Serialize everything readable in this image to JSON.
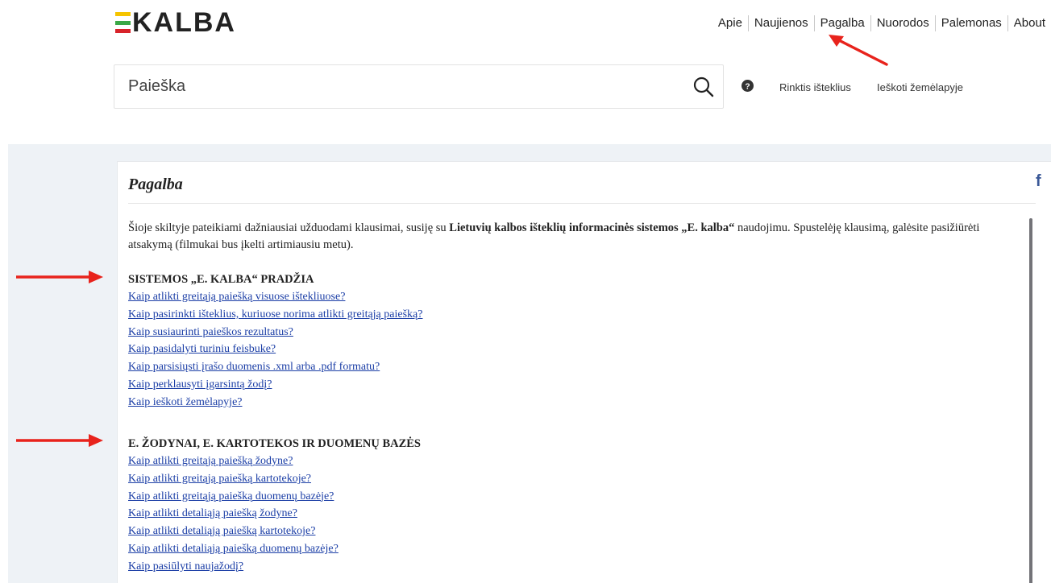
{
  "brand": {
    "name": "KALBA",
    "mark_colors": [
      "#f5c400",
      "#39a846",
      "#d8232a"
    ]
  },
  "nav": {
    "items": [
      {
        "label": "Apie"
      },
      {
        "label": "Naujienos"
      },
      {
        "label": "Pagalba"
      },
      {
        "label": "Nuorodos"
      },
      {
        "label": "Palemonas"
      },
      {
        "label": "About"
      }
    ]
  },
  "search": {
    "placeholder": "Paieška",
    "button_icon": "search-icon",
    "help_icon": "question-circle-icon"
  },
  "aux_links": {
    "choose_resources": "Rinktis išteklius",
    "map_search": "Ieškoti žemėlapyje"
  },
  "page": {
    "title": "Pagalba",
    "share_icon": "facebook-icon",
    "intro_before": "Šioje skiltyje pateikiami dažniausiai užduodami klausimai, susiję su ",
    "intro_bold": "Lietuvių kalbos išteklių informacinės sistemos „E. kalba“",
    "intro_after": " naudojimu. Spustelėję klausimą, galėsite pasižiūrėti atsakymą (filmukai bus įkelti artimiausiu metu)."
  },
  "sections": [
    {
      "heading": "SISTEMOS „E. KALBA“ PRADŽIA",
      "links": [
        "Kaip atlikti greitąją paiešką visuose ištekliuose?",
        "Kaip pasirinkti išteklius, kuriuose norima atlikti greitąją paiešką?",
        "Kaip susiaurinti paieškos rezultatus?",
        "Kaip pasidalyti turiniu feisbuke?",
        "Kaip parsisiųsti įrašo duomenis .xml arba .pdf formatu?",
        "Kaip perklausyti įgarsintą žodį?",
        "Kaip ieškoti žemėlapyje?"
      ]
    },
    {
      "heading": "E. ŽODYNAI, E. KARTOTEKOS IR DUOMENŲ BAZĖS",
      "links": [
        "Kaip atlikti greitąją paiešką žodyne?",
        "Kaip atlikti greitąją paiešką kartotekoje?",
        "Kaip atlikti greitąją paiešką duomenų bazėje?",
        "Kaip atlikti detaliąją paiešką žodyne?",
        "Kaip atlikti detaliąją paiešką kartotekoje?",
        "Kaip atlikti detaliąją paiešką duomenų bazėje?",
        "Kaip pasiūlyti naujažodį?"
      ]
    }
  ],
  "colors": {
    "link": "#1b3ea6",
    "annotation_arrow": "#e8231c",
    "band_background": "#eef2f6"
  }
}
